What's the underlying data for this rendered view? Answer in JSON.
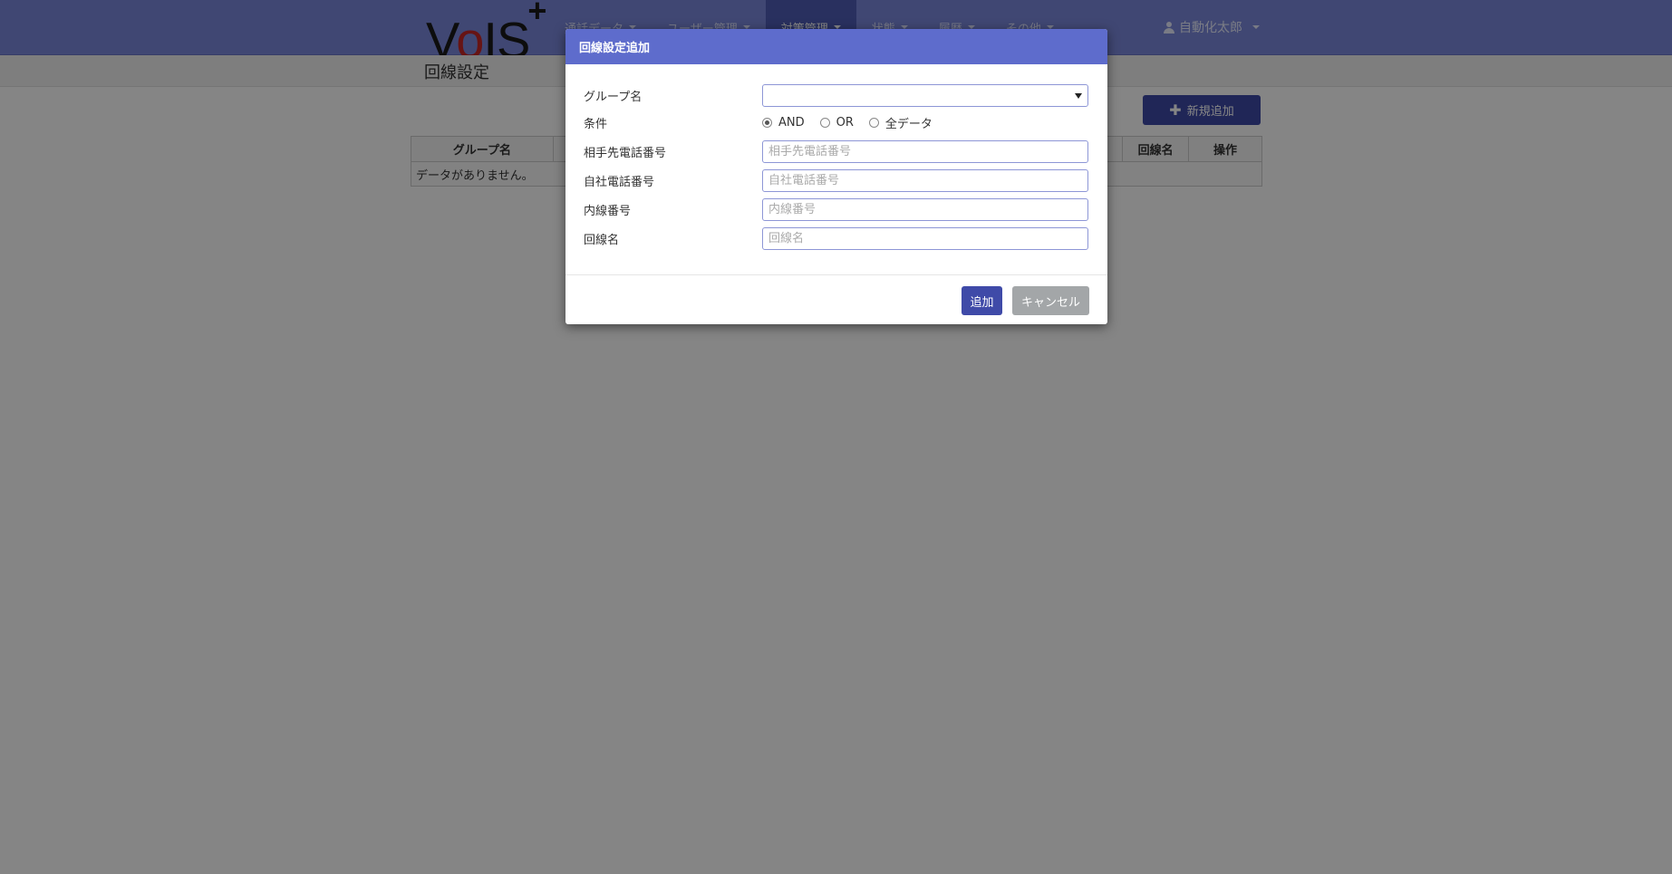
{
  "app": {
    "logo_text": "VoIS",
    "logo_plus": "+"
  },
  "nav": {
    "items": [
      {
        "label": "通話データ"
      },
      {
        "label": "ユーザー管理"
      },
      {
        "label": "対策管理"
      },
      {
        "label": "状態"
      },
      {
        "label": "履歴"
      },
      {
        "label": "その他"
      }
    ],
    "active_index": 2,
    "user_name": "自動化太郎"
  },
  "page": {
    "title": "回線設定",
    "add_new_label": "新規追加",
    "table": {
      "columns": [
        "グループ名",
        "回線名",
        "操作"
      ],
      "empty_message": "データがありません。"
    }
  },
  "modal": {
    "title": "回線設定追加",
    "fields": {
      "group_label": "グループ名",
      "group_value": "",
      "condition_label": "条件",
      "condition_options": [
        "AND",
        "OR",
        "全データ"
      ],
      "condition_selected": "AND",
      "other_phone_label": "相手先電話番号",
      "other_phone_placeholder": "相手先電話番号",
      "own_phone_label": "自社電話番号",
      "own_phone_placeholder": "自社電話番号",
      "extension_label": "内線番号",
      "extension_placeholder": "内線番号",
      "line_name_label": "回線名",
      "line_name_placeholder": "回線名"
    },
    "buttons": {
      "add": "追加",
      "cancel": "キャンセル"
    }
  },
  "colors": {
    "navbar": "#7c89dc",
    "nav_active": "#4f5cb6",
    "modal_header": "#5e6ccc",
    "primary_button": "#3f4aa8",
    "cancel_button": "#a3a6a8"
  }
}
